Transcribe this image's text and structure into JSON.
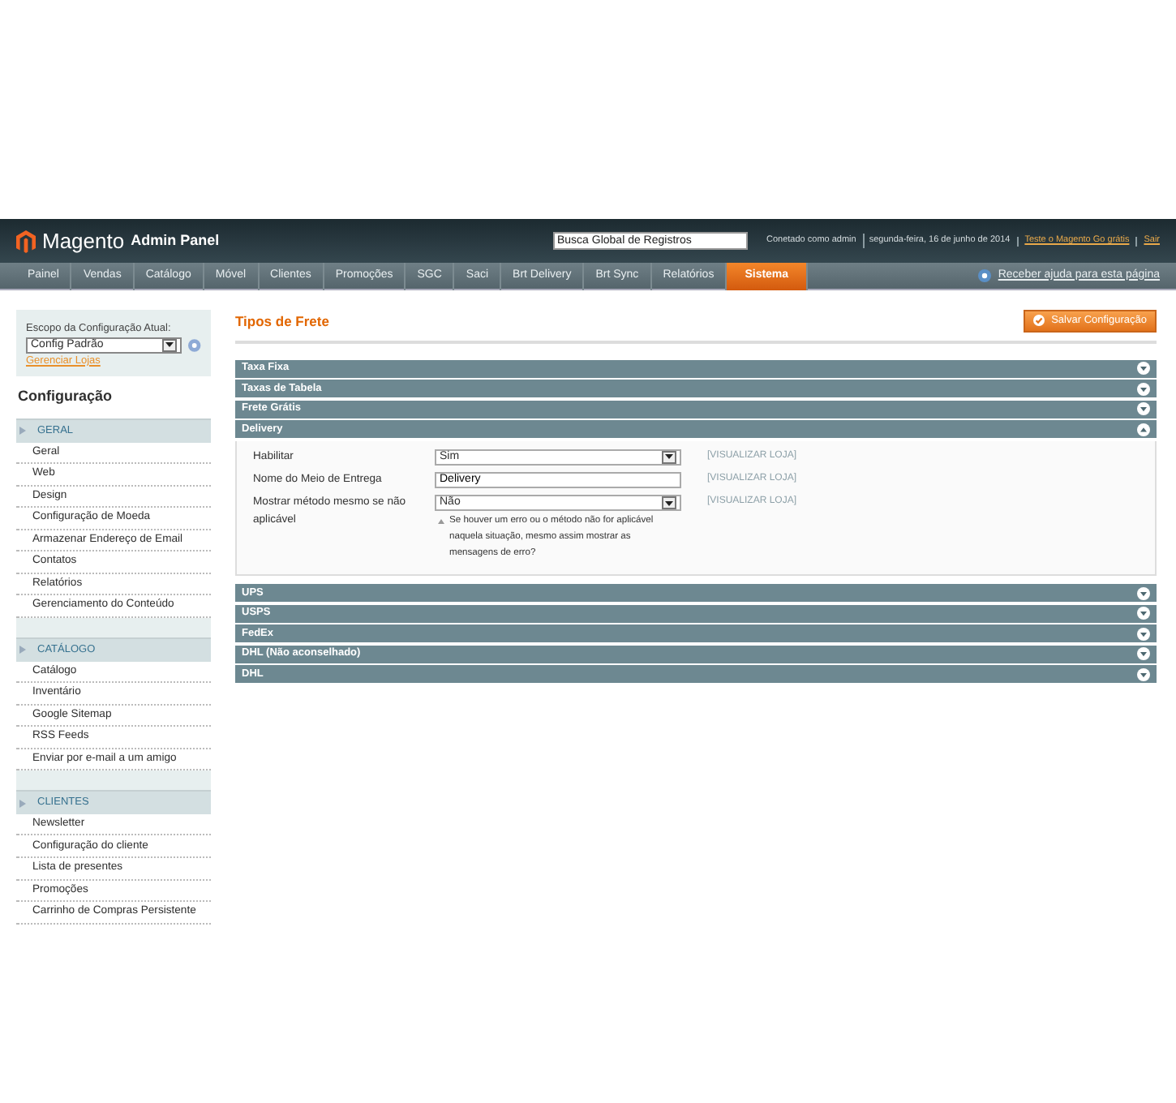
{
  "header": {
    "logo": "Magento",
    "logo_sub": "Admin Panel",
    "search": {
      "value": "Busca Global de Registros"
    },
    "user_info": "Conetado como admin",
    "date": "segunda-feira, 16 de junho de 2014",
    "links": [
      "Teste o Magento Go grátis",
      "Sair"
    ]
  },
  "nav": {
    "items": [
      {
        "label": "Painel",
        "selected": false
      },
      {
        "label": "Vendas",
        "selected": false
      },
      {
        "label": "Catálogo",
        "selected": false
      },
      {
        "label": "Móvel",
        "selected": false
      },
      {
        "label": "Clientes",
        "selected": false
      },
      {
        "label": "Promoções",
        "selected": false
      },
      {
        "label": "SGC",
        "selected": false
      },
      {
        "label": "Saci",
        "selected": false
      },
      {
        "label": "Brt Delivery",
        "selected": false
      },
      {
        "label": "Brt Sync",
        "selected": false
      },
      {
        "label": "Relatórios",
        "selected": false
      },
      {
        "label": "Sistema",
        "selected": true
      }
    ],
    "help": "Receber ajuda para esta página"
  },
  "sidebar": {
    "scope_label": "Escopo da Configuração Atual:",
    "scope_value": "Config Padrão",
    "manage_link": "Gerenciar Lojas",
    "title": "Configuração",
    "groups": [
      {
        "title": "GERAL",
        "items": [
          "Geral",
          "Web",
          "Design",
          "Configuração de Moeda",
          "Armazenar Endereço de Email",
          "Contatos",
          "Relatórios",
          "Gerenciamento do Conteúdo"
        ]
      },
      {
        "title": "CATÁLOGO",
        "items": [
          "Catálogo",
          "Inventário",
          "Google Sitemap",
          "RSS Feeds",
          "Enviar por e-mail a um amigo"
        ]
      },
      {
        "title": "CLIENTES",
        "items": [
          "Newsletter",
          "Configuração do cliente",
          "Lista de presentes",
          "Promoções",
          "Carrinho de Compras Persistente"
        ]
      }
    ]
  },
  "main": {
    "title": "Tipos de Frete",
    "save_button": "Salvar Configuração",
    "sections": [
      {
        "title": "Taxa Fixa",
        "expanded": false
      },
      {
        "title": "Taxas de Tabela",
        "expanded": false
      },
      {
        "title": "Frete Grátis",
        "expanded": false
      },
      {
        "title": "Delivery",
        "expanded": true,
        "fields": [
          {
            "kind": "select",
            "label": "Habilitar",
            "value": "Sim",
            "scope": "[VISUALIZAR LOJA]"
          },
          {
            "kind": "text",
            "label": "Nome do Meio de Entrega",
            "value": "Delivery",
            "scope": "[VISUALIZAR LOJA]"
          },
          {
            "kind": "select",
            "label": "Mostrar método mesmo se não aplicável",
            "value": "Não",
            "scope": "[VISUALIZAR LOJA]",
            "note": "Se houver um erro ou o método não for aplicável naquela situação, mesmo assim mostrar as mensagens de erro?"
          }
        ]
      },
      {
        "title": "UPS",
        "expanded": false
      },
      {
        "title": "USPS",
        "expanded": false
      },
      {
        "title": "FedEx",
        "expanded": false
      },
      {
        "title": "DHL (Não aconselhado)",
        "expanded": false
      },
      {
        "title": "DHL",
        "expanded": false
      }
    ]
  }
}
